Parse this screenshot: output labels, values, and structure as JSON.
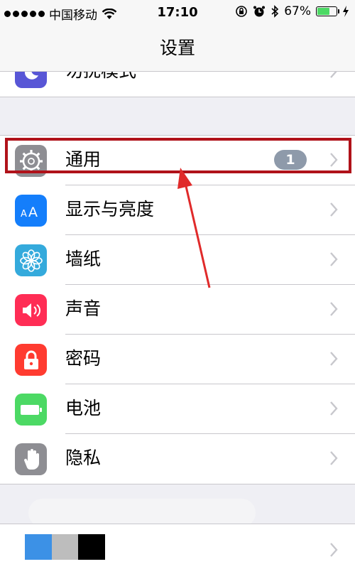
{
  "status": {
    "carrier": "中国移动",
    "time": "17:10",
    "battery_percent": "67%",
    "battery_level": 0.67
  },
  "nav": {
    "title": "设置"
  },
  "rows": [
    {
      "label": "勿扰模式",
      "icon": "moon-icon",
      "color": "#5856d6"
    },
    {
      "label": "通用",
      "icon": "gear-icon",
      "color": "#8e8e93",
      "badge": "1"
    },
    {
      "label": "显示与亮度",
      "icon": "text-size-icon",
      "color": "#147efb"
    },
    {
      "label": "墙纸",
      "icon": "flower-icon",
      "color": "#34aadc"
    },
    {
      "label": "声音",
      "icon": "speaker-icon",
      "color": "#ff2d55"
    },
    {
      "label": "密码",
      "icon": "lock-icon",
      "color": "#ff3b30"
    },
    {
      "label": "电池",
      "icon": "battery-icon",
      "color": "#4cd964"
    },
    {
      "label": "隐私",
      "icon": "hand-icon",
      "color": "#8e8e93"
    }
  ],
  "annotation": {
    "color": "#b0121a"
  },
  "bottom_colors": [
    "#3c91e6",
    "#bdbdbd",
    "#000000"
  ]
}
